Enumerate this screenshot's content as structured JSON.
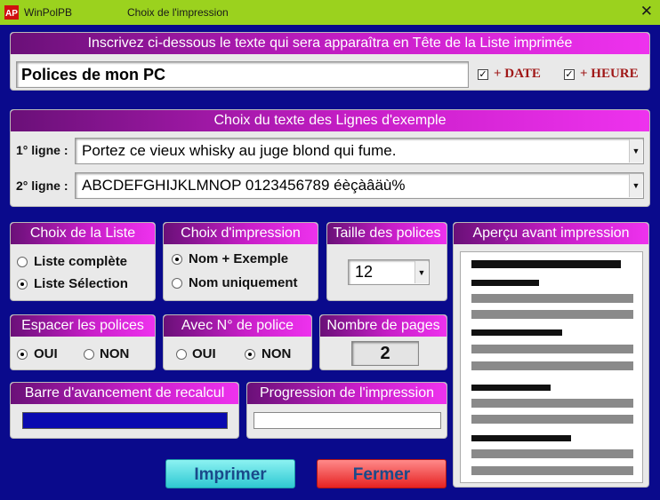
{
  "window": {
    "app_name": "WinPolPB",
    "title": "Choix de l'impression",
    "close_symbol": "✕"
  },
  "header": {
    "heading": "Inscrivez ci-dessous le texte qui sera apparaîtra en Tête de la Liste imprimée",
    "text_value": "Polices de mon PC",
    "date_label": "+ DATE",
    "date_checked": true,
    "time_label": "+ HEURE",
    "time_checked": true
  },
  "samples": {
    "heading": "Choix du texte des Lignes d'exemple",
    "line1_label": "1° ligne :",
    "line1_value": "Portez ce vieux whisky au juge blond qui fume.",
    "line2_label": "2° ligne :",
    "line2_value": "ABCDEFGHIJKLMNOP 0123456789 éèçàâäù%"
  },
  "list_choice": {
    "heading": "Choix de la Liste",
    "options": [
      "Liste complète",
      "Liste Sélection"
    ],
    "selected": "Liste Sélection"
  },
  "print_choice": {
    "heading": "Choix d'impression",
    "options": [
      "Nom + Exemple",
      "Nom uniquement"
    ],
    "selected": "Nom + Exemple"
  },
  "font_size": {
    "heading": "Taille des polices",
    "value": "12"
  },
  "spacing": {
    "heading": "Espacer les polices",
    "options": [
      "OUI",
      "NON"
    ],
    "selected": "OUI"
  },
  "font_number": {
    "heading": "Avec N° de police",
    "options": [
      "OUI",
      "NON"
    ],
    "selected": "NON"
  },
  "pages": {
    "heading": "Nombre de pages",
    "value": "2"
  },
  "recalc_progress": {
    "heading": "Barre d'avancement de recalcul",
    "fraction": 1.0
  },
  "print_progress": {
    "heading": "Progression de l'impression",
    "fraction": 0.0
  },
  "preview": {
    "heading": "Aperçu avant impression"
  },
  "buttons": {
    "print": "Imprimer",
    "close": "Fermer"
  },
  "colors": {
    "background": "#0a0a8c",
    "titlebar": "#9bd21e",
    "header_accent": "#c81ec8",
    "progress": "#0a0ab0"
  },
  "icons": {
    "app": "app-logo-icon",
    "close": "close-icon",
    "dropdown": "chevron-down-icon"
  }
}
